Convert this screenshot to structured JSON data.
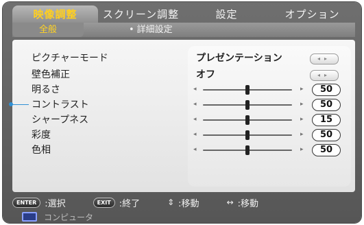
{
  "tabs": [
    "映像調整",
    "スクリーン調整",
    "設定",
    "オプション"
  ],
  "subtabs": {
    "active": "全般",
    "other": "詳細設定",
    "bullet": "•"
  },
  "rows": [
    {
      "label": "ピクチャーモード",
      "value": "プレゼンテーション",
      "type": "select"
    },
    {
      "label": "壁色補正",
      "value": "オフ",
      "type": "select"
    },
    {
      "label": "明るさ",
      "value": "50",
      "type": "slider",
      "level": 0.5
    },
    {
      "label": "コントラスト",
      "value": "50",
      "type": "slider",
      "level": 0.5
    },
    {
      "label": "シャープネス",
      "value": "15",
      "type": "slider",
      "level": 0.5
    },
    {
      "label": "彩度",
      "value": "50",
      "type": "slider",
      "level": 0.5
    },
    {
      "label": "色相",
      "value": "50",
      "type": "slider",
      "level": 0.5
    }
  ],
  "footer": {
    "enter_key": "ENTER",
    "enter_text": ":選択",
    "exit_key": "EXIT",
    "exit_text": ":終了",
    "updown_sym": "⇕",
    "updown_text": ":移動",
    "leftright_sym": "↔",
    "leftright_text": ":移動"
  },
  "source": {
    "label": "コンピュータ",
    "icon": "computer-icon"
  },
  "colors": {
    "active_tab_text": "#ffcf1f",
    "panel": "#eeeeee",
    "frame": "#5f5f5f"
  }
}
